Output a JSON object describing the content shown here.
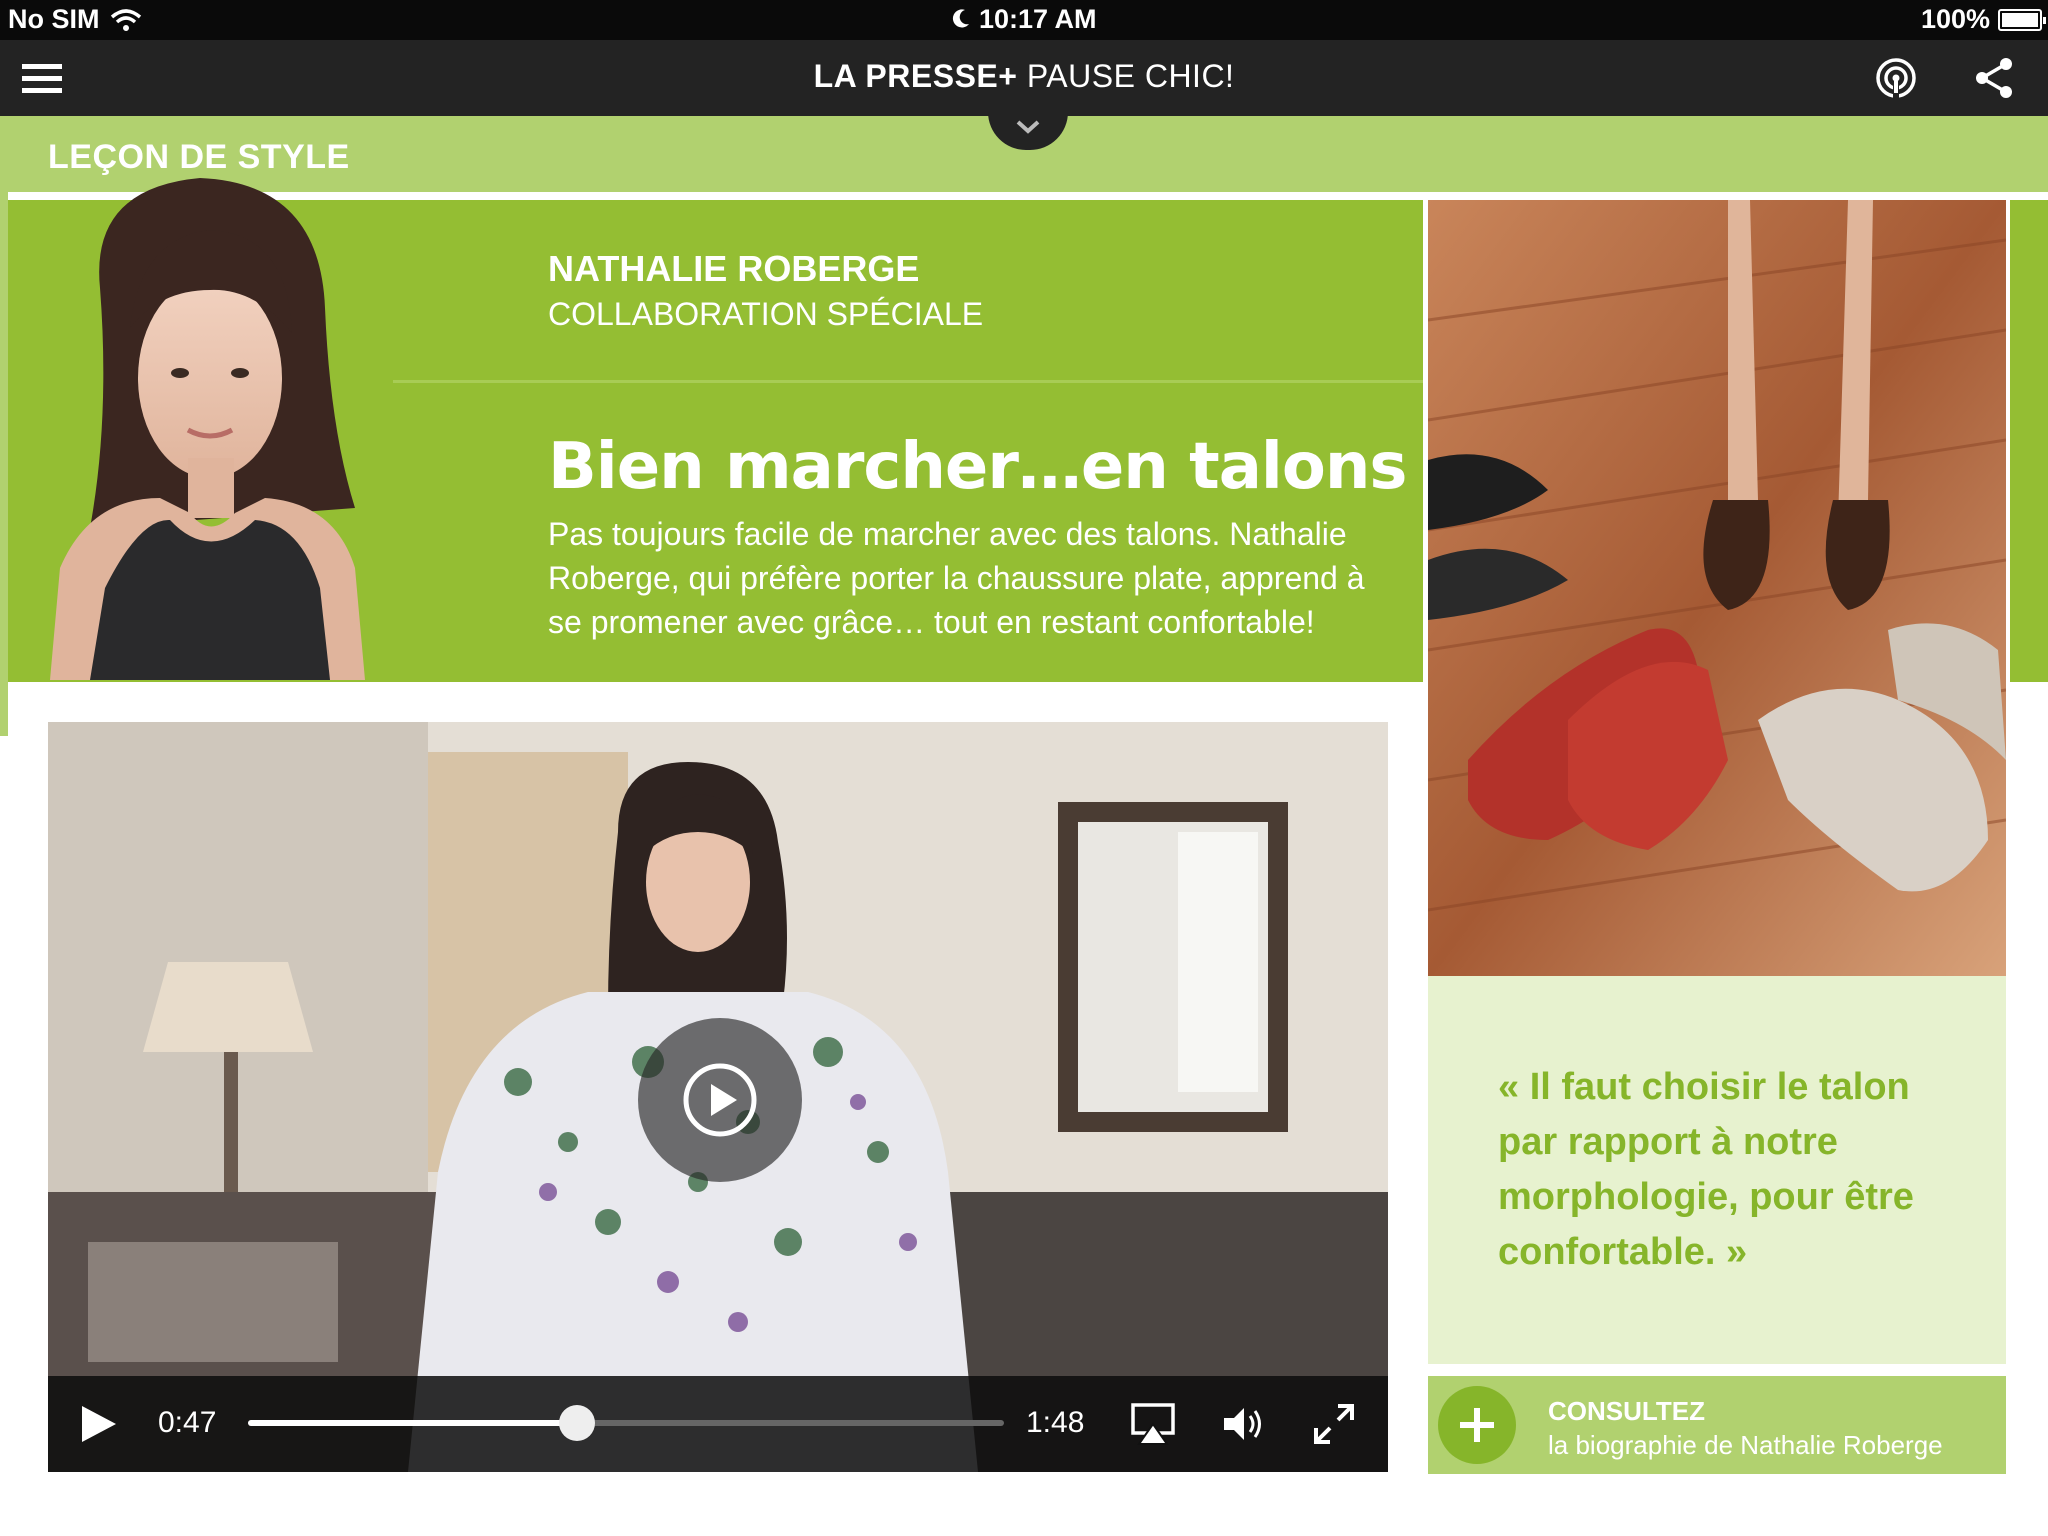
{
  "status_bar": {
    "carrier": "No SIM",
    "time": "10:17 AM",
    "battery": "100%"
  },
  "nav": {
    "brand": "LA PRESSE+",
    "section": "PAUSE CHIC!"
  },
  "section_label": "LEÇON DE STYLE",
  "article": {
    "author": "NATHALIE ROBERGE",
    "role": "COLLABORATION SPÉCIALE",
    "headline": "Bien marcher…en talons",
    "lede": "Pas toujours facile de marcher avec des talons. Nathalie Roberge, qui préfère porter la chaussure plate, apprend à se promener avec grâce… tout en restant confortable!"
  },
  "quote": "« Il faut choisir le talon par rapport à notre morphologie, pour être confortable. »",
  "bio_link": {
    "title": "CONSULTEZ",
    "subtitle": "la biographie de Nathalie Roberge"
  },
  "video": {
    "current_time": "0:47",
    "duration": "1:48",
    "progress": 0.435
  },
  "colors": {
    "accent_green": "#94be33",
    "light_green": "#b1d16f",
    "pale_green": "#e7f2cf",
    "quote_green": "#86b52a",
    "nav_dark": "#232323"
  },
  "icons": [
    "menu-icon",
    "podcast-icon",
    "share-icon",
    "chevron-down-icon",
    "play-icon",
    "airplay-icon",
    "volume-icon",
    "fullscreen-icon",
    "plus-icon",
    "wifi-icon",
    "moon-icon",
    "battery-icon"
  ]
}
